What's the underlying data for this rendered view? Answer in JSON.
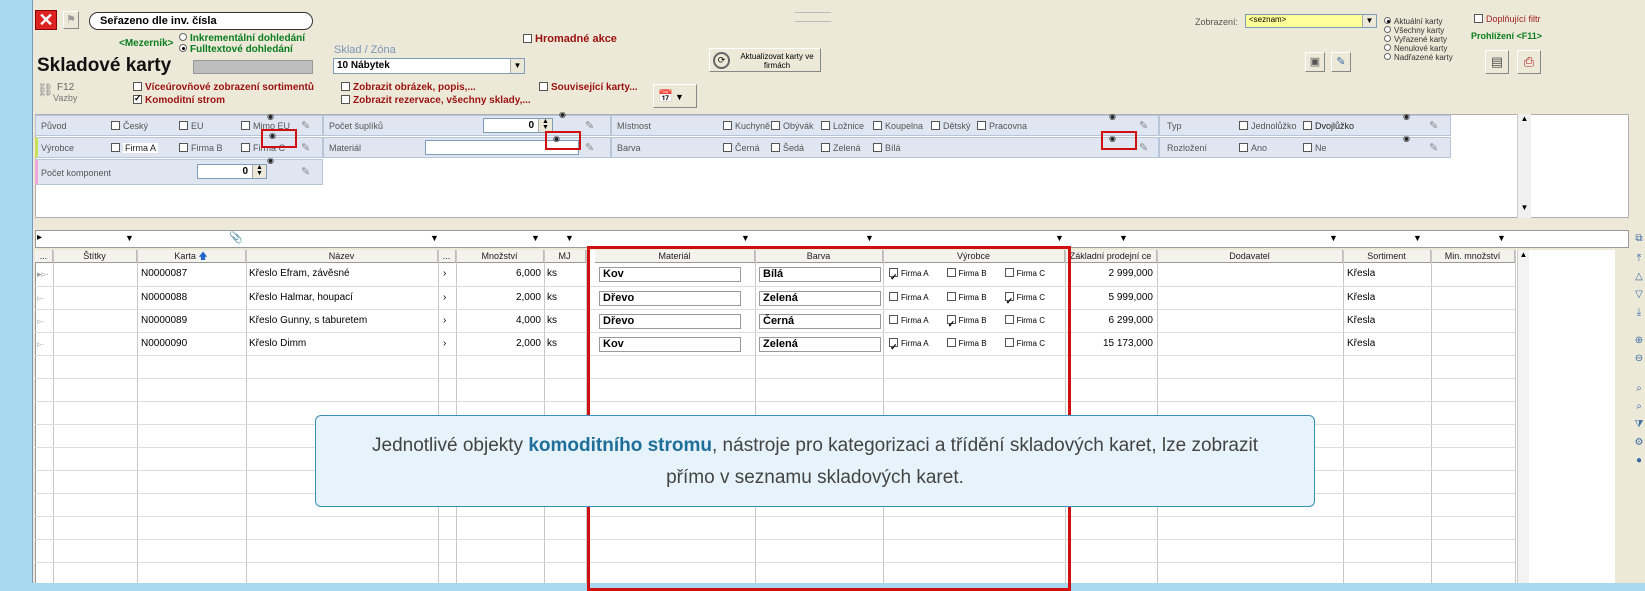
{
  "toolbar": {
    "sort_label": "Seřazeno dle inv. čísla",
    "mezernik": "<Mezerník>",
    "search_incr": "Inkrementální dohledání",
    "search_full": "Fulltextové dohledání",
    "title": "Skladové karty",
    "sklad_label": "Sklad / Zóna",
    "sklad_value": "10  Nábytek",
    "hromadne": "Hromadné akce",
    "aktualizovat": "Aktualizovat karty ve firmách",
    "zobrazeni_label": "Zobrazení:",
    "zobrazeni_value": "<seznam>",
    "radio_options": [
      "Aktuální karty",
      "Všechny karty",
      "Vyřazené karty",
      "Nenulové karty",
      "Nadřazené karty"
    ],
    "doplnujici_filtr": "Doplňující filtr",
    "prohlizeni": "Prohlížení <F11>",
    "f12": "F12",
    "vazby": "Vazby",
    "viceurovnove": "Víceúrovňové zobrazení sortimentů",
    "komoditni": "Komoditní strom",
    "zobrazit_obrazek": "Zobrazit obrázek, popis,...",
    "zobrazit_rezervace": "Zobrazit rezervace, všechny sklady,...",
    "souvisejici": "Související karty..."
  },
  "filters": {
    "puvod": {
      "label": "Původ",
      "options": [
        "Český",
        "EU",
        "Mimo EU"
      ]
    },
    "vyrobce": {
      "label": "Výrobce",
      "options": [
        "Firma A",
        "Firma B",
        "Firma C"
      ]
    },
    "pocet_komponent": {
      "label": "Počet komponent",
      "value": "0"
    },
    "pocet_suplíku": {
      "label": "Počet šuplíků",
      "value": "0"
    },
    "material": {
      "label": "Materiál"
    },
    "mistnost": {
      "label": "Místnost",
      "options": [
        "Kuchyně",
        "Obývák",
        "Ložnice",
        "Koupelna",
        "Dětský",
        "Pracovna"
      ]
    },
    "barva": {
      "label": "Barva",
      "options": [
        "Černá",
        "Šedá",
        "Zelená",
        "Bílá"
      ]
    },
    "typ": {
      "label": "Typ",
      "options": [
        "Jednolůžko",
        "Dvojlůžko"
      ]
    },
    "rozlozeni": {
      "label": "Rozložení",
      "options": [
        "Ano",
        "Ne"
      ]
    }
  },
  "table": {
    "headers": [
      "...",
      "Štítky",
      "Karta",
      "Název",
      "...",
      "Množství",
      "MJ",
      "Materiál",
      "Barva",
      "Výrobce",
      "Základní prodejní ce",
      "Dodavatel",
      "Sortiment",
      "Min. množství"
    ],
    "rows": [
      {
        "karta": "N0000087",
        "nazev": "Křeslo Efram, závěsné",
        "mnozstvi": "6,000",
        "mj": "ks",
        "material": "Kov",
        "barva": "Bílá",
        "firmaA": true,
        "firmaB": false,
        "firmaC": false,
        "cena": "2 999,000",
        "sortiment": "Křesla"
      },
      {
        "karta": "N0000088",
        "nazev": "Křeslo Halmar, houpací",
        "mnozstvi": "2,000",
        "mj": "ks",
        "material": "Dřevo",
        "barva": "Zelená",
        "firmaA": false,
        "firmaB": false,
        "firmaC": true,
        "cena": "5 999,000",
        "sortiment": "Křesla"
      },
      {
        "karta": "N0000089",
        "nazev": "Křeslo Gunny, s taburetem",
        "mnozstvi": "4,000",
        "mj": "ks",
        "material": "Dřevo",
        "barva": "Černá",
        "firmaA": false,
        "firmaB": true,
        "firmaC": false,
        "cena": "6 299,000",
        "sortiment": "Křesla"
      },
      {
        "karta": "N0000090",
        "nazev": "Křeslo Dimm",
        "mnozstvi": "2,000",
        "mj": "ks",
        "material": "Kov",
        "barva": "Zelená",
        "firmaA": true,
        "firmaB": false,
        "firmaC": false,
        "cena": "15 173,000",
        "sortiment": "Křesla"
      }
    ],
    "firm_labels": [
      "Firma A",
      "Firma B",
      "Firma C"
    ]
  },
  "callout": {
    "pre": "Jednotlivé objekty ",
    "bold": "komoditního stromu",
    "post": ", nástroje pro kategorizaci a třídění skladových karet, lze zobrazit přímo v seznamu skladových karet."
  },
  "colors": {
    "accent_red": "#d01010",
    "callout_bg": "#e6f3fa",
    "callout_border": "#3c8fb8",
    "bold_text": "#1f6f9a"
  }
}
